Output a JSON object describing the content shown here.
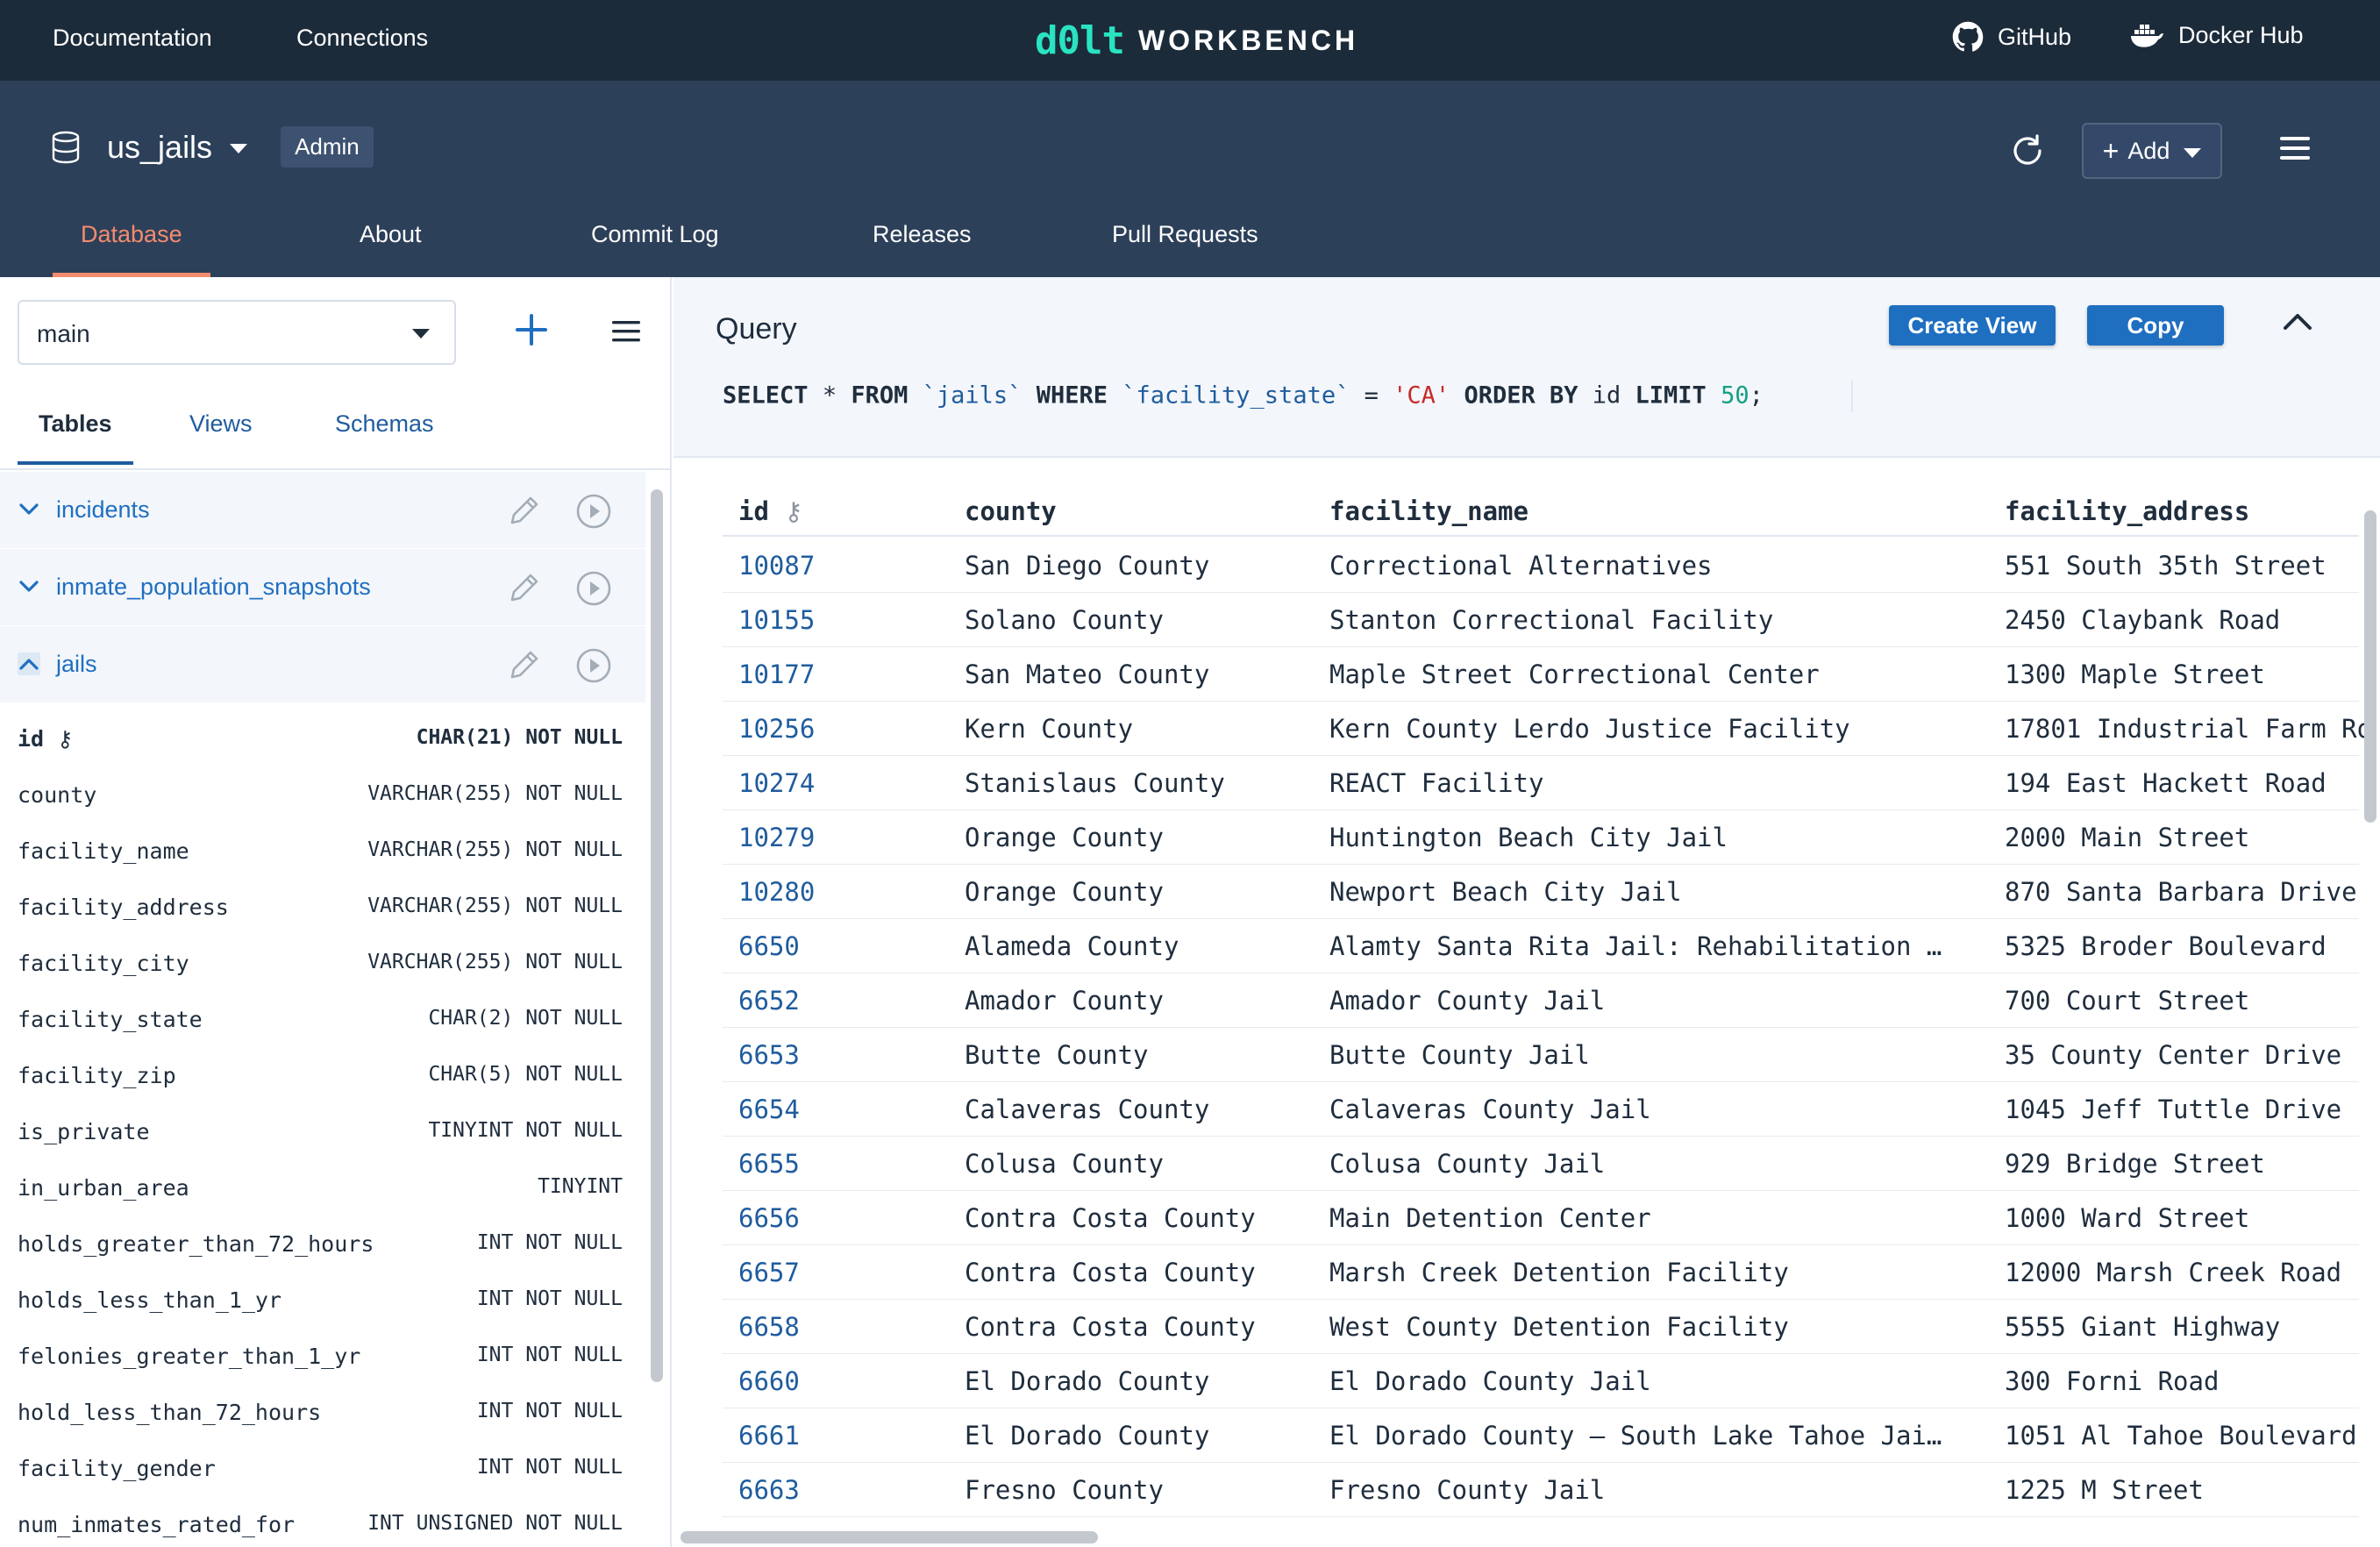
{
  "topnav": {
    "links": [
      "Documentation",
      "Connections"
    ],
    "logo_mark": "d0lt",
    "logo_text": "WORKBENCH",
    "external": [
      {
        "label": "GitHub",
        "icon": "github-icon"
      },
      {
        "label": "Docker Hub",
        "icon": "docker-icon"
      }
    ]
  },
  "header": {
    "database_name": "us_jails",
    "role_badge": "Admin",
    "add_label": "Add",
    "tabs": [
      "Database",
      "About",
      "Commit Log",
      "Releases",
      "Pull Requests"
    ],
    "active_tab": "Database",
    "accent_color": "#f48b6e"
  },
  "sidebar": {
    "branch": "main",
    "subtabs": [
      "Tables",
      "Views",
      "Schemas"
    ],
    "active_subtab": "Tables",
    "tables": [
      {
        "name": "incidents",
        "expanded": false
      },
      {
        "name": "inmate_population_snapshots",
        "expanded": false
      },
      {
        "name": "jails",
        "expanded": true
      }
    ],
    "columns": [
      {
        "name": "id",
        "type": "CHAR(21) NOT NULL",
        "primary_key": true
      },
      {
        "name": "county",
        "type": "VARCHAR(255) NOT NULL"
      },
      {
        "name": "facility_name",
        "type": "VARCHAR(255) NOT NULL"
      },
      {
        "name": "facility_address",
        "type": "VARCHAR(255) NOT NULL"
      },
      {
        "name": "facility_city",
        "type": "VARCHAR(255) NOT NULL"
      },
      {
        "name": "facility_state",
        "type": "CHAR(2) NOT NULL"
      },
      {
        "name": "facility_zip",
        "type": "CHAR(5) NOT NULL"
      },
      {
        "name": "is_private",
        "type": "TINYINT NOT NULL"
      },
      {
        "name": "in_urban_area",
        "type": "TINYINT"
      },
      {
        "name": "holds_greater_than_72_hours",
        "type": "INT NOT NULL"
      },
      {
        "name": "holds_less_than_1_yr",
        "type": "INT NOT NULL"
      },
      {
        "name": "felonies_greater_than_1_yr",
        "type": "INT NOT NULL"
      },
      {
        "name": "hold_less_than_72_hours",
        "type": "INT NOT NULL"
      },
      {
        "name": "facility_gender",
        "type": "INT NOT NULL"
      },
      {
        "name": "num_inmates_rated_for",
        "type": "INT UNSIGNED NOT NULL"
      }
    ]
  },
  "query": {
    "title": "Query",
    "create_view_label": "Create View",
    "copy_label": "Copy",
    "sql": {
      "select": "SELECT",
      "star": "*",
      "from": "FROM",
      "table": "`jails`",
      "where": "WHERE",
      "column": "`facility_state`",
      "eq": "=",
      "value": "'CA'",
      "order": "ORDER BY",
      "order_col": "id",
      "limit": "LIMIT",
      "limit_val": "50",
      "end": ";"
    }
  },
  "results": {
    "headers": [
      "id",
      "county",
      "facility_name",
      "facility_address"
    ],
    "rows": [
      [
        "10087",
        "San Diego County",
        "Correctional Alternatives",
        "551 South 35th Street"
      ],
      [
        "10155",
        "Solano County",
        "Stanton Correctional Facility",
        "2450 Claybank Road"
      ],
      [
        "10177",
        "San Mateo County",
        "Maple Street Correctional Center",
        "1300 Maple Street"
      ],
      [
        "10256",
        "Kern County",
        "Kern County Lerdo Justice Facility",
        "17801 Industrial Farm Ro"
      ],
      [
        "10274",
        "Stanislaus County",
        "REACT Facility",
        "194 East Hackett Road"
      ],
      [
        "10279",
        "Orange County",
        "Huntington Beach City Jail",
        "2000 Main Street"
      ],
      [
        "10280",
        "Orange County",
        "Newport Beach City Jail",
        "870 Santa Barbara Drive"
      ],
      [
        "6650",
        "Alameda County",
        "Alamty Santa Rita Jail: Rehabilitation …",
        "5325 Broder Boulevard"
      ],
      [
        "6652",
        "Amador County",
        "Amador County Jail",
        "700 Court Street"
      ],
      [
        "6653",
        "Butte County",
        "Butte County Jail",
        "35 County Center Drive"
      ],
      [
        "6654",
        "Calaveras County",
        "Calaveras County Jail",
        "1045 Jeff Tuttle Drive"
      ],
      [
        "6655",
        "Colusa County",
        "Colusa County Jail",
        "929 Bridge Street"
      ],
      [
        "6656",
        "Contra Costa County",
        "Main Detention Center",
        "1000 Ward Street"
      ],
      [
        "6657",
        "Contra Costa County",
        "Marsh Creek Detention Facility",
        "12000 Marsh Creek Road"
      ],
      [
        "6658",
        "Contra Costa County",
        "West County Detention Facility",
        "5555 Giant Highway"
      ],
      [
        "6660",
        "El Dorado County",
        "El Dorado County Jail",
        "300 Forni Road"
      ],
      [
        "6661",
        "El Dorado County",
        "El Dorado County – South Lake Tahoe Jai…",
        "1051 Al Tahoe Boulevard"
      ],
      [
        "6663",
        "Fresno County",
        "Fresno County Jail",
        "1225 M Street"
      ]
    ]
  }
}
